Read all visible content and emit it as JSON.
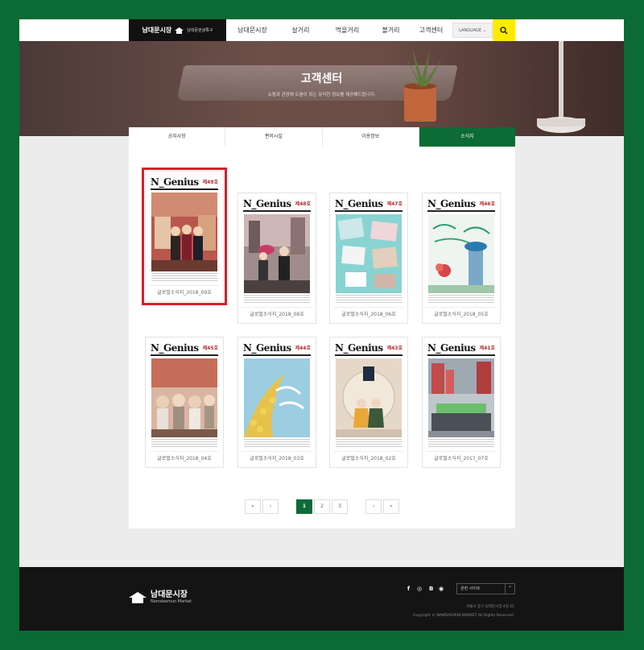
{
  "header": {
    "logo_main": "남대문시장",
    "logo_sub": "남대문관광특구",
    "menu": [
      "남대문시장",
      "살거리",
      "먹을거리",
      "볼거리",
      "고객센터"
    ],
    "language_label": "LANGUAGE",
    "search_icon": "search-icon"
  },
  "hero": {
    "title": "고객센터",
    "subtitle": "쇼핑과 관광에 도움이 되는 유익한 정보를 제공해드립니다."
  },
  "tabs": [
    "공지사항",
    "편의시설",
    "이용정보",
    "소식지"
  ],
  "active_tab": "소식지",
  "newsletters": [
    {
      "brand": "N_Genius",
      "issue": "제49호",
      "caption": "글로벌소식지_2018_09호",
      "selected": true
    },
    {
      "brand": "N_Genius",
      "issue": "제48호",
      "caption": "글로벌소식지_2018_08호"
    },
    {
      "brand": "N_Genius",
      "issue": "제47호",
      "caption": "글로벌소식지_2018_06호"
    },
    {
      "brand": "N_Genius",
      "issue": "제46호",
      "caption": "글로벌소식지_2018_05호"
    },
    {
      "brand": "N_Genius",
      "issue": "제45호",
      "caption": "글로벌소식지_2018_04호"
    },
    {
      "brand": "N_Genius",
      "issue": "제44호",
      "caption": "글로벌소식지_2018_03호"
    },
    {
      "brand": "N_Genius",
      "issue": "제43호",
      "caption": "글로벌소식지_2018_02호"
    },
    {
      "brand": "N_Genius",
      "issue": "제41호",
      "caption": "글로벌소식지_2017_07호"
    }
  ],
  "pagination": {
    "first": "«",
    "prev": "‹",
    "pages": [
      "1",
      "2",
      "3"
    ],
    "current": "1",
    "next": "›",
    "last": "»"
  },
  "footer": {
    "logo_name": "남대문시장",
    "logo_eng": "Namdaemun Market",
    "social": [
      "f",
      "◎",
      "B",
      "◉"
    ],
    "related_label": "관련 사이트",
    "address": "서울시 중구 남대문시장 4길 21",
    "copyright": "Copyright © NAMDAEMUN MARKET All Rights Reserved."
  },
  "colors": {
    "brand_green": "#0d6b36",
    "border_green": "#0c6a35",
    "search_yellow": "#ffeb00",
    "selected_red": "#d5202c"
  }
}
